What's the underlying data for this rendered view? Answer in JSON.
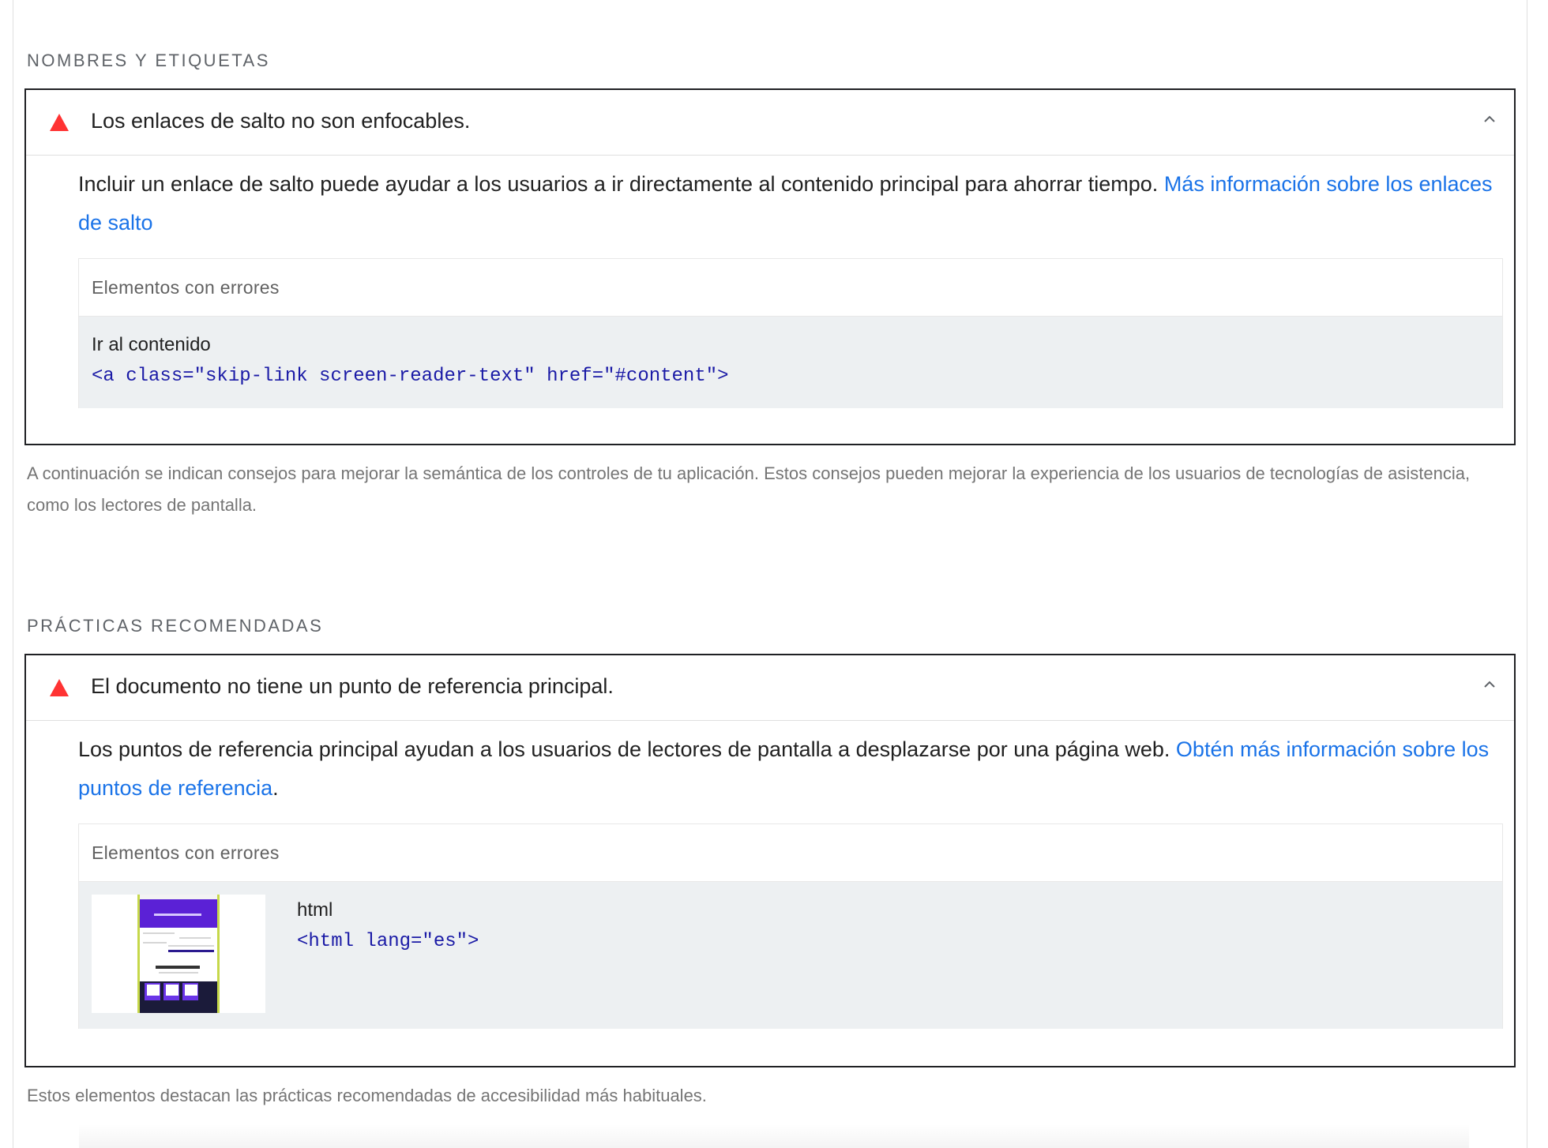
{
  "sections": [
    {
      "title": "NOMBRES Y ETIQUETAS",
      "audit": {
        "title": "Los enlaces de salto no son enfocables.",
        "description": "Incluir un enlace de salto puede ayudar a los usuarios a ir directamente al contenido principal para ahorrar tiempo. ",
        "link_text": "Más información sobre los enlaces de salto",
        "link_suffix": "",
        "table_header": "Elementos con errores",
        "node_label": "Ir al contenido",
        "node_snippet": "<a class=\"skip-link screen-reader-text\" href=\"#content\">"
      },
      "note": "A continuación se indican consejos para mejorar la semántica de los controles de tu aplicación. Estos consejos pueden mejorar la experiencia de los usuarios de tecnologías de asistencia, como los lectores de pantalla."
    },
    {
      "title": "PRÁCTICAS RECOMENDADAS",
      "audit": {
        "title": "El documento no tiene un punto de referencia principal.",
        "description": "Los puntos de referencia principal ayudan a los usuarios de lectores de pantalla a desplazarse por una página web. ",
        "link_text": "Obtén más información sobre los puntos de referencia",
        "link_suffix": ".",
        "table_header": "Elementos con errores",
        "node_label": "html",
        "node_snippet": "<html lang=\"es\">"
      },
      "note": "Estos elementos destacan las prácticas recomendadas de accesibilidad más habituales."
    }
  ],
  "icons": {
    "fail": "warning-triangle-icon",
    "collapse": "chevron-up-icon"
  },
  "colors": {
    "fail": "#ff3333",
    "link": "#1a73e8",
    "code": "#1a1aa6",
    "row_bg": "#edf0f2"
  }
}
